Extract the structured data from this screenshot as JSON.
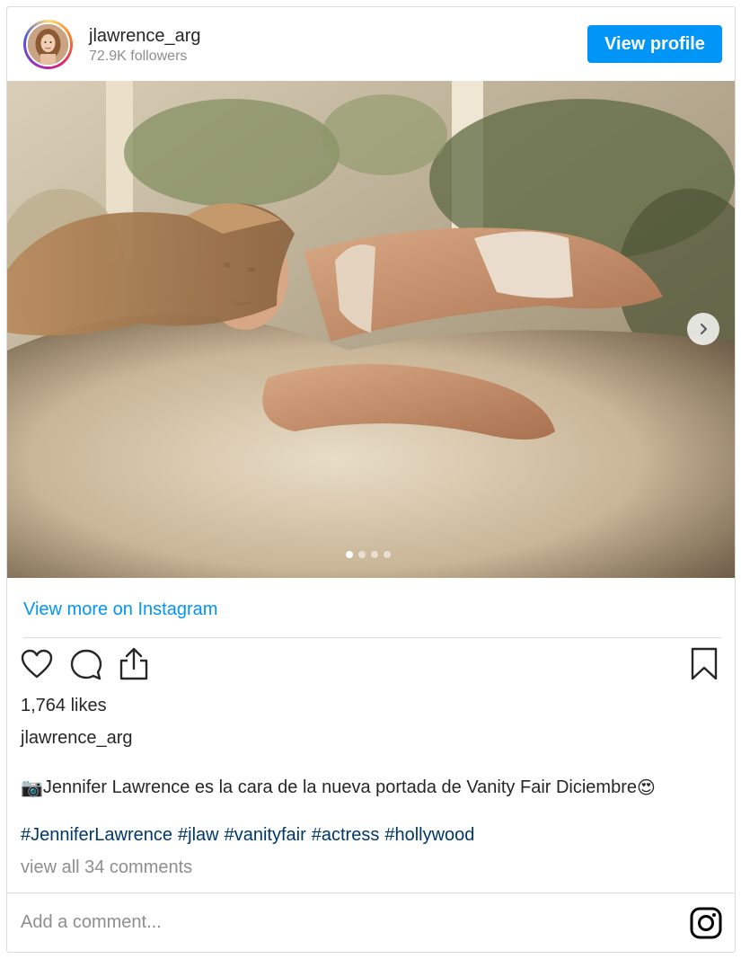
{
  "header": {
    "username": "jlawrence_arg",
    "followers": "72.9K followers",
    "view_profile_label": "View profile"
  },
  "carousel": {
    "slide_count": 4,
    "active_index": 0
  },
  "post": {
    "view_more_label": "View more on Instagram",
    "likes": "1,764 likes",
    "caption_username": "jlawrence_arg",
    "caption_emoji_start": "📷",
    "caption_text": " Jennifer Lawrence es la cara de la nueva portada de Vanity Fair Diciembre ",
    "caption_emoji_end": "😍",
    "hashtags": [
      "#JenniferLawrence",
      "#jlaw",
      "#vanityfair",
      "#actress",
      "#hollywood"
    ],
    "view_comments": "view all 34 comments"
  },
  "comment_box": {
    "placeholder": "Add a comment..."
  },
  "icons": {
    "like": "heart-icon",
    "comment": "comment-icon",
    "share": "share-icon",
    "save": "bookmark-icon",
    "next": "chevron-right-icon",
    "brand": "instagram-icon"
  },
  "colors": {
    "accent": "#0095f6",
    "hashtag": "#00376b",
    "muted": "#8e8e8e",
    "border": "#dbdbdb"
  }
}
